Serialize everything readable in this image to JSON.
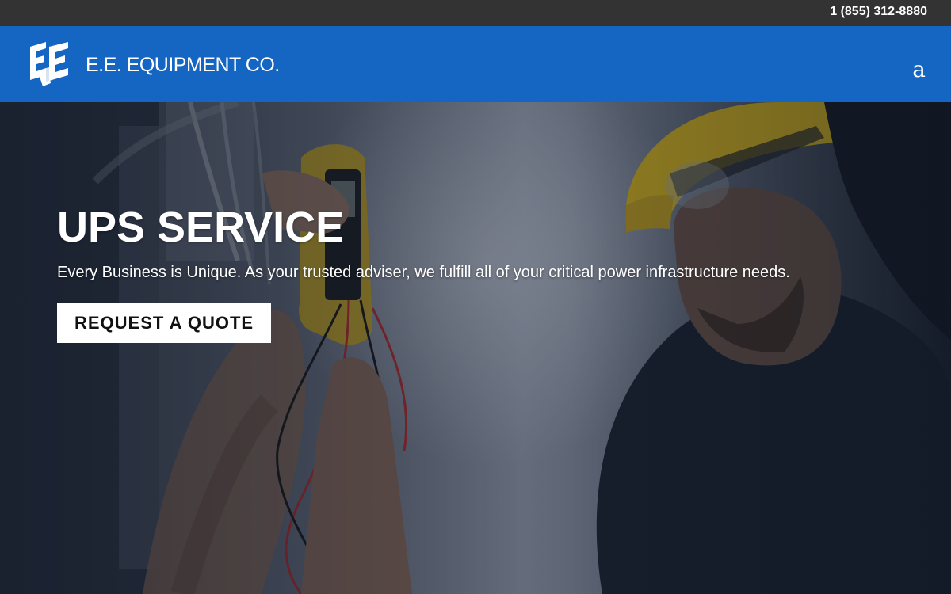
{
  "topbar": {
    "phone": "1 (855) 312-8880"
  },
  "header": {
    "logo_text": "E.E. EQUIPMENT CO.",
    "logo_icon": "ee-logo-mark",
    "menu_toggle": "a"
  },
  "hero": {
    "title": "UPS SERVICE",
    "subtitle": "Every Business is Unique. As your trusted adviser, we fulfill all of your critical power infrastructure needs.",
    "cta_label": "REQUEST A QUOTE",
    "background": "technician-with-multimeter-photo"
  },
  "colors": {
    "topbar_bg": "#333333",
    "nav_bg": "#1565c3",
    "cta_bg": "#ffffff",
    "cta_text": "#111111"
  }
}
